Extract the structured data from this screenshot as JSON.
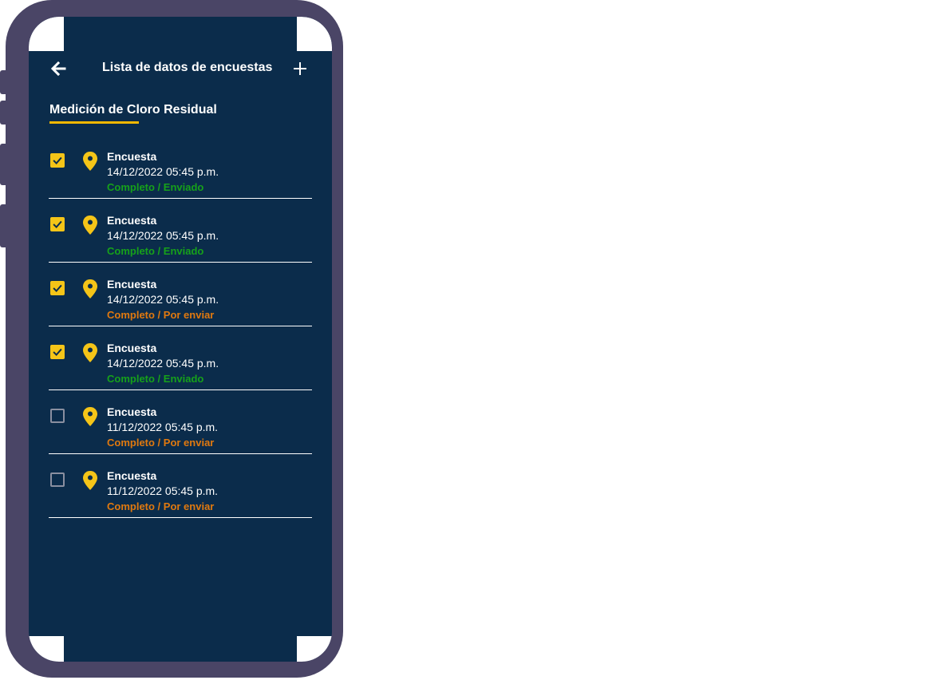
{
  "header": {
    "title": "Lista de datos de encuestas",
    "back_icon": "arrow-left-icon",
    "add_icon": "plus-icon"
  },
  "section": {
    "title": "Medición de Cloro Residual"
  },
  "colors": {
    "background": "#0b2c4b",
    "accent": "#f5c518",
    "status_sent": "#16a11a",
    "status_pending": "#e0790f",
    "frame": "#4a4566"
  },
  "surveys": [
    {
      "name": "Encuesta",
      "date": "14/12/2022 05:45 p.m.",
      "status": "Completo / Enviado",
      "status_type": "sent",
      "checked": true
    },
    {
      "name": "Encuesta",
      "date": "14/12/2022 05:45 p.m.",
      "status": "Completo / Enviado",
      "status_type": "sent",
      "checked": true
    },
    {
      "name": "Encuesta",
      "date": "14/12/2022 05:45 p.m.",
      "status": "Completo / Por enviar",
      "status_type": "pending",
      "checked": true
    },
    {
      "name": "Encuesta",
      "date": "14/12/2022 05:45 p.m.",
      "status": "Completo / Enviado",
      "status_type": "sent",
      "checked": true
    },
    {
      "name": "Encuesta",
      "date": "11/12/2022 05:45 p.m.",
      "status": "Completo / Por enviar",
      "status_type": "pending",
      "checked": false
    },
    {
      "name": "Encuesta",
      "date": "11/12/2022 05:45 p.m.",
      "status": "Completo / Por enviar",
      "status_type": "pending",
      "checked": false
    }
  ]
}
